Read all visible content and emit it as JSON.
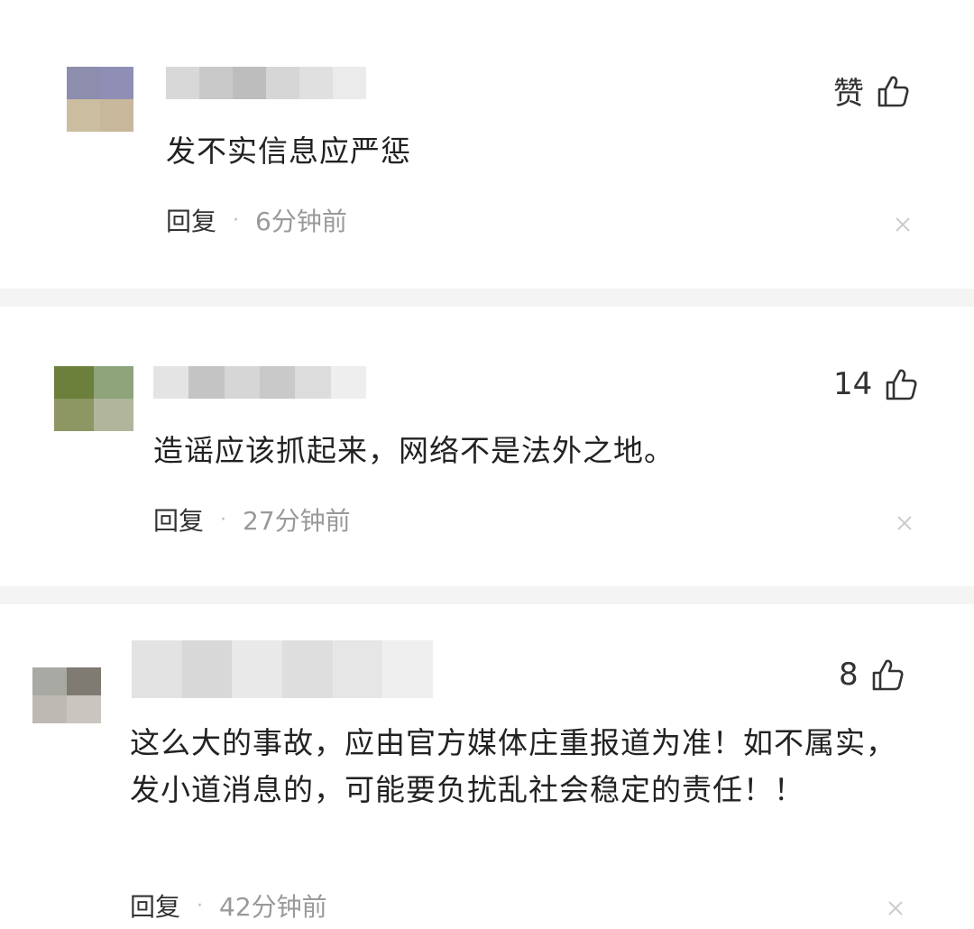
{
  "colors": {
    "text_primary": "#222222",
    "text_secondary": "#999999",
    "separator": "#f4f4f4"
  },
  "comments": [
    {
      "text": "发不实信息应严惩",
      "like_label": "赞",
      "reply_label": "回复",
      "separator": "·",
      "time": "6分钟前",
      "avatar_colors": [
        "#8d8dae",
        "#8f8fb6",
        "#cbbd9f",
        "#c8b79b"
      ],
      "name_blur_colors": [
        "#d8d8d8",
        "#c9c9c9",
        "#bdbdbd",
        "#d6d6d6",
        "#e0e0e0",
        "#ebebeb"
      ]
    },
    {
      "text": "造谣应该抓起来，网络不是法外之地。",
      "like_label": "14",
      "reply_label": "回复",
      "separator": "·",
      "time": "27分钟前",
      "avatar_colors": [
        "#6c7f3b",
        "#8ea47a",
        "#8d9763",
        "#b0b59c"
      ],
      "name_blur_colors": [
        "#e4e4e4",
        "#c4c4c4",
        "#d6d6d6",
        "#c9c9c9",
        "#dcdcdc",
        "#eeeeee"
      ]
    },
    {
      "text": "这么大的事故，应由官方媒体庄重报道为准！如不属实，发小道消息的，可能要负扰乱社会稳定的责任！！",
      "like_label": "8",
      "reply_label": "回复",
      "separator": "·",
      "time": "42分钟前",
      "avatar_colors": [
        "#a9a9a3",
        "#7f7a72",
        "#bdb9b3",
        "#c9c6c0"
      ],
      "name_blur_colors": [
        "#e3e3e3",
        "#d8d8d8",
        "#e9e9e9",
        "#dedede",
        "#e6e6e6",
        "#efefef"
      ]
    }
  ]
}
